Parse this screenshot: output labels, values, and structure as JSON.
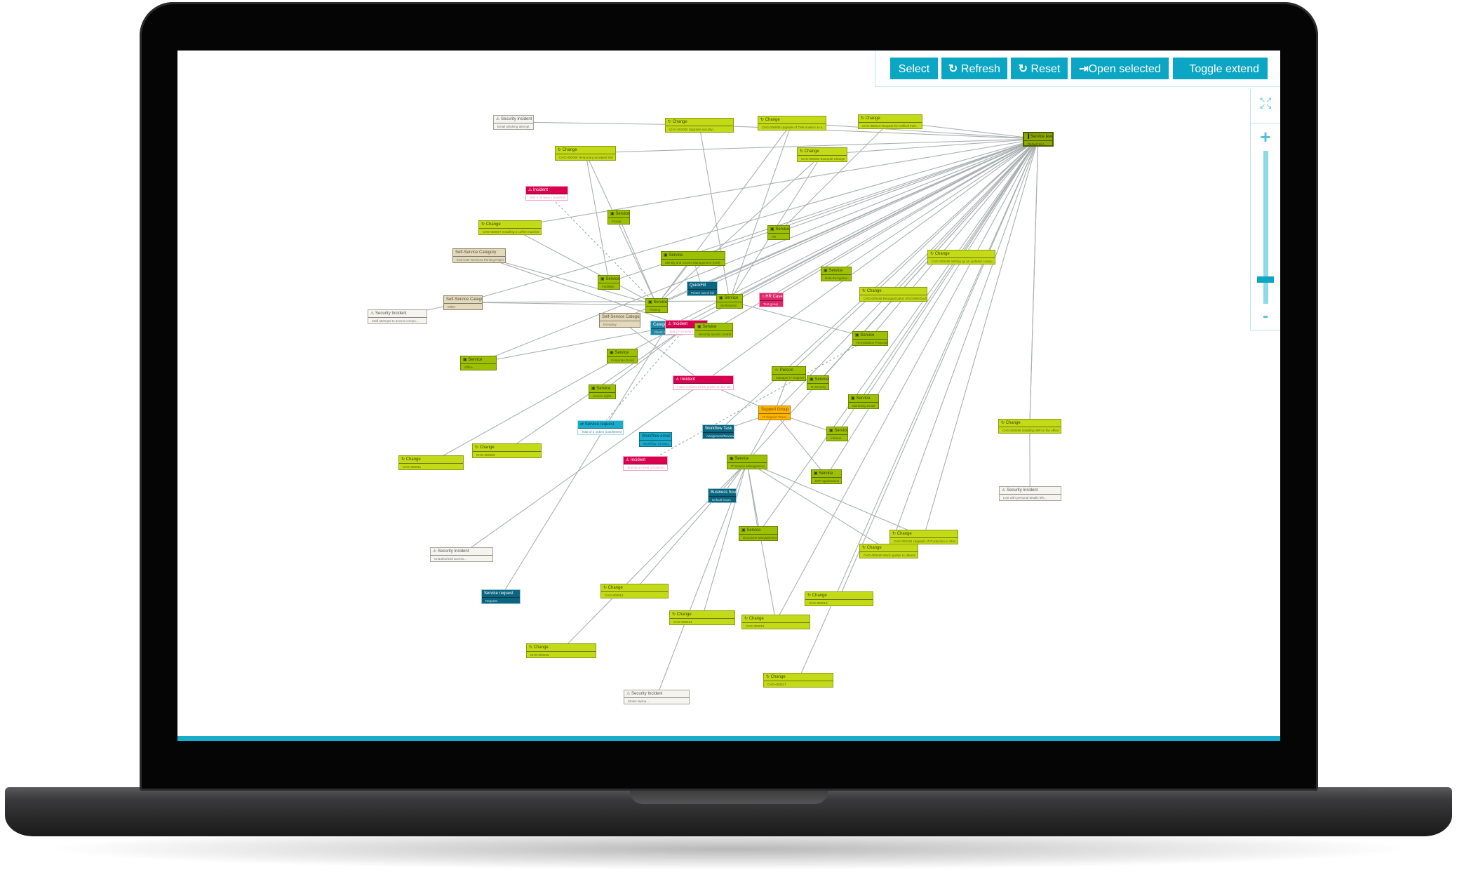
{
  "toolbar": {
    "select_label": "Select",
    "refresh_label": "Refresh",
    "reset_label": "Reset",
    "open_selected_label": "Open selected",
    "toggle_extend_label": "Toggle extend",
    "refresh_icon": "refresh-icon",
    "reset_icon": "refresh-icon",
    "open_selected_icon": "sign-in-icon"
  },
  "zoom_controls": {
    "fit_icon": "expand-arrows-icon",
    "zoom_in_label": "+",
    "zoom_out_label": "-",
    "zoom_level_fraction": 0.16
  },
  "colors": {
    "accent": "#0ba6c3",
    "change": "#c3da17",
    "service": "#9dc000",
    "incident": "#d8004f",
    "support_group": "#ffb400",
    "workflow": "#0b6580",
    "self_service_category": "#e3d9bd",
    "security_incident": "#f5f4ee"
  },
  "graph": {
    "nodes": [
      {
        "type": "secinc",
        "title": "Security Incident",
        "subtitle": "Email phishing attempt"
      },
      {
        "type": "change",
        "title": "Change",
        "subtitle": "CHG-000005 Upgrade security..."
      },
      {
        "type": "change",
        "title": "Change",
        "subtitle": "CHG-000008 Upgrade of TMS solution to a..."
      },
      {
        "type": "change",
        "title": "Change",
        "subtitle": "CHG-000010 Request for Artifical Intel..."
      },
      {
        "type": "sla",
        "title": "Service level",
        "subtitle": "Default SLA"
      },
      {
        "type": "change",
        "title": "Change",
        "subtitle": "CHG-000006 Temporary accepted risk"
      },
      {
        "type": "change",
        "title": "Change",
        "subtitle": "CHG-000004 Example Change"
      },
      {
        "type": "incident",
        "title": "Incident",
        "subtitle": "Test 4 on level 1 frontend"
      },
      {
        "type": "service",
        "title": "Service",
        "subtitle": "Faxing"
      },
      {
        "type": "change",
        "title": "Change",
        "subtitle": "CHG-000007 Installing a coffee machine"
      },
      {
        "type": "service",
        "title": "Service",
        "subtitle": "HR"
      },
      {
        "type": "ssc",
        "title": "Self-Service Category",
        "subtitle": "End User Services-Printing Paper"
      },
      {
        "type": "service",
        "title": "Service",
        "subtitle": "Identity and Access Management (IAM)"
      },
      {
        "type": "change",
        "title": "Change",
        "subtitle": "CHG-000466 Setting up an updated compu..."
      },
      {
        "type": "service",
        "title": "Service",
        "subtitle": "Data Encryption"
      },
      {
        "type": "service",
        "title": "Service",
        "subtitle": "Facilities"
      },
      {
        "type": "dark",
        "title": "QuickFill",
        "subtitle": "Printer out of ink"
      },
      {
        "type": "service",
        "title": "Service",
        "subtitle": "Workstation"
      },
      {
        "type": "hrcase",
        "title": "HR Case",
        "subtitle": "Test group"
      },
      {
        "type": "change",
        "title": "Change",
        "subtitle": "CHG-000468 Reorganization of ED/WM facilites"
      },
      {
        "type": "ssc",
        "title": "Self-Service Category",
        "subtitle": "Other"
      },
      {
        "type": "secinc",
        "title": "Security Incident",
        "subtitle": "Staff attempts to access compu..."
      },
      {
        "type": "service",
        "title": "Service",
        "subtitle": "Printing"
      },
      {
        "type": "ssc",
        "title": "Self-Service Category",
        "subtitle": "Everyday"
      },
      {
        "type": "category",
        "title": "Category",
        "subtitle": "Client Access"
      },
      {
        "type": "incident",
        "title": "Incident",
        "subtitle": "Test 10 on level 1 frontend"
      },
      {
        "type": "service",
        "title": "Service",
        "subtitle": "Security access control"
      },
      {
        "type": "service",
        "title": "Service",
        "subtitle": "Remediation Proposal"
      },
      {
        "type": "service",
        "title": "Service",
        "subtitle": "Corporate Email"
      },
      {
        "type": "service",
        "title": "Service",
        "subtitle": "Office"
      },
      {
        "type": "person",
        "title": "Person",
        "subtitle": "Manager IT Support"
      },
      {
        "type": "service",
        "title": "Service",
        "subtitle": "IT Security"
      },
      {
        "type": "incident",
        "title": "Incident",
        "subtitle": "I can't connect to the printer on the 4th"
      },
      {
        "type": "service",
        "title": "Service",
        "subtitle": "Access rights"
      },
      {
        "type": "service",
        "title": "Service",
        "subtitle": "Marketing Email"
      },
      {
        "type": "support",
        "title": "Support Group",
        "subtitle": "IT Support Team"
      },
      {
        "type": "sreq",
        "title": "Service request",
        "subtitle": "Total of 3 orders (£32/letters)"
      },
      {
        "type": "dark",
        "title": "Workflow Task",
        "subtitle": "Assignment/Reviewer"
      },
      {
        "type": "service",
        "title": "Service",
        "subtitle": "Intranet"
      },
      {
        "type": "wfemail",
        "title": "Workflow email",
        "subtitle": "Workflow: Closing"
      },
      {
        "type": "change",
        "title": "Change",
        "subtitle": "CHG-000485 Installing WiFi in the office"
      },
      {
        "type": "change",
        "title": "Change",
        "subtitle": "CHG-000011"
      },
      {
        "type": "change",
        "title": "Change",
        "subtitle": "CHG-000009"
      },
      {
        "type": "incident",
        "title": "Incident",
        "subtitle": "Test 09 on level 3 frontend"
      },
      {
        "type": "service",
        "title": "Service",
        "subtitle": "IT Service Management"
      },
      {
        "type": "service",
        "title": "Service",
        "subtitle": "ERP applications"
      },
      {
        "type": "secinc",
        "title": "Security Incident",
        "subtitle": "Lost with personal details left..."
      },
      {
        "type": "dark",
        "title": "Business hours",
        "subtitle": "Default hours"
      },
      {
        "type": "service",
        "title": "Service",
        "subtitle": "Document Management"
      },
      {
        "type": "change",
        "title": "Change",
        "subtitle": "CHG-000481 Upgrade of Production to Stan..."
      },
      {
        "type": "change",
        "title": "Change",
        "subtitle": "CHG-000480 Word update to Ubuntu"
      },
      {
        "type": "secinc",
        "title": "Security Incident",
        "subtitle": "Unauthorized access..."
      },
      {
        "type": "dark",
        "title": "Service request",
        "subtitle": "Request"
      },
      {
        "type": "change",
        "title": "Change",
        "subtitle": "CHG-000012"
      },
      {
        "type": "change",
        "title": "Change",
        "subtitle": "CHG-000013"
      },
      {
        "type": "change",
        "title": "Change",
        "subtitle": "CHG-000014"
      },
      {
        "type": "change",
        "title": "Change",
        "subtitle": "CHG-000015"
      },
      {
        "type": "change",
        "title": "Change",
        "subtitle": "CHG-000016"
      },
      {
        "type": "change",
        "title": "Change",
        "subtitle": "CHG-000017"
      },
      {
        "type": "secinc",
        "title": "Security Incident",
        "subtitle": "Stolen laptop..."
      }
    ],
    "edges": [
      [
        1,
        4
      ],
      [
        2,
        4
      ],
      [
        3,
        4
      ],
      [
        5,
        4
      ],
      [
        6,
        4
      ],
      [
        9,
        4
      ],
      [
        12,
        4
      ],
      [
        13,
        4
      ],
      [
        14,
        4
      ],
      [
        16,
        4
      ],
      [
        17,
        4
      ],
      [
        18,
        4
      ],
      [
        19,
        4
      ],
      [
        20,
        4
      ],
      [
        22,
        4
      ],
      [
        24,
        4
      ],
      [
        25,
        4
      ],
      [
        26,
        4
      ],
      [
        27,
        4
      ],
      [
        28,
        4
      ],
      [
        30,
        4
      ],
      [
        31,
        4
      ],
      [
        32,
        4
      ],
      [
        34,
        4
      ],
      [
        35,
        4
      ],
      [
        37,
        4
      ],
      [
        38,
        4
      ],
      [
        40,
        4
      ],
      [
        44,
        4
      ],
      [
        45,
        4
      ],
      [
        48,
        4
      ],
      [
        49,
        4
      ],
      [
        50,
        4
      ],
      [
        54,
        4
      ],
      [
        56,
        4
      ],
      [
        58,
        4
      ],
      [
        10,
        4
      ],
      [
        15,
        4
      ],
      [
        23,
        4
      ],
      [
        29,
        4
      ],
      [
        0,
        1
      ],
      [
        5,
        15
      ],
      [
        5,
        22
      ],
      [
        1,
        17
      ],
      [
        8,
        22
      ],
      [
        11,
        22
      ],
      [
        11,
        25
      ],
      [
        9,
        22
      ],
      [
        20,
        22
      ],
      [
        20,
        17
      ],
      [
        21,
        20
      ],
      [
        29,
        24
      ],
      [
        41,
        28
      ],
      [
        42,
        25
      ],
      [
        51,
        32
      ],
      [
        52,
        24
      ],
      [
        57,
        44
      ],
      [
        59,
        44
      ],
      [
        53,
        44
      ],
      [
        55,
        44
      ],
      [
        56,
        44
      ],
      [
        35,
        44
      ],
      [
        35,
        45
      ],
      [
        35,
        38
      ],
      [
        35,
        37
      ],
      [
        35,
        32
      ],
      [
        30,
        35
      ],
      [
        44,
        47
      ],
      [
        44,
        49
      ],
      [
        44,
        50
      ],
      [
        44,
        48
      ],
      [
        46,
        40
      ],
      [
        40,
        4
      ],
      [
        2,
        17
      ],
      [
        2,
        22
      ],
      [
        3,
        10
      ],
      [
        6,
        17
      ],
      [
        6,
        22
      ],
      [
        12,
        22
      ],
      [
        12,
        16
      ],
      [
        27,
        17
      ],
      [
        33,
        25
      ],
      [
        23,
        32
      ]
    ],
    "dashed_edges": [
      [
        7,
        22
      ],
      [
        36,
        25
      ],
      [
        43,
        27
      ]
    ]
  }
}
